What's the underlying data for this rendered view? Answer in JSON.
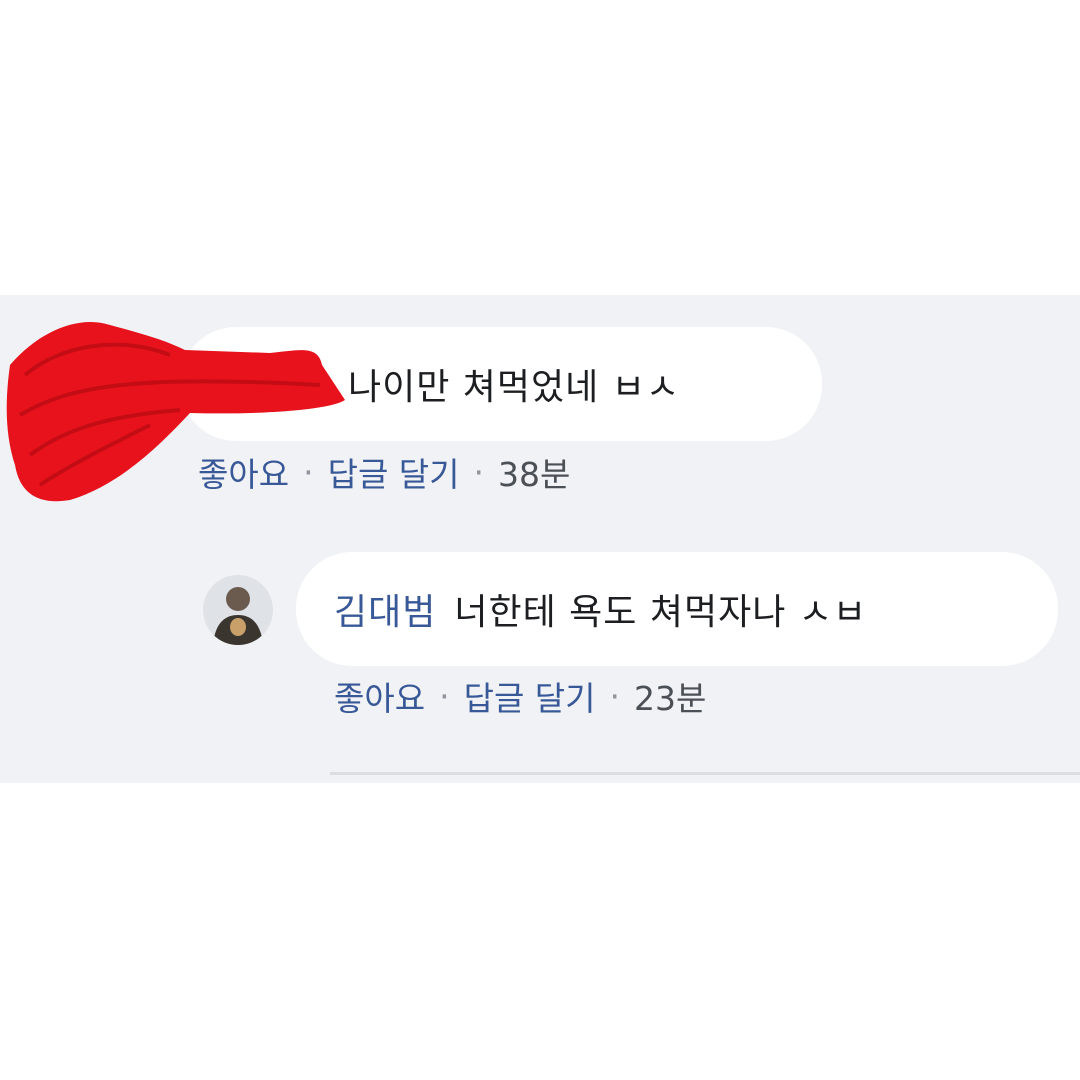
{
  "comments": [
    {
      "text": "나이만 쳐먹었네 ㅂㅅ",
      "actions": {
        "like": "좋아요",
        "reply": "답글 달기",
        "separator": "·",
        "time": "38분"
      }
    },
    {
      "author": "김대범",
      "text": "너한테 욕도 쳐먹자나 ㅅㅂ",
      "avatar_icon": "user-photo-avatar",
      "actions": {
        "like": "좋아요",
        "reply": "답글 달기",
        "separator": "·",
        "time": "23분"
      }
    }
  ],
  "colors": {
    "panel_background": "#f0f2f5",
    "bubble": "#ffffff",
    "link": "#385898",
    "redaction": "#e8121c"
  }
}
